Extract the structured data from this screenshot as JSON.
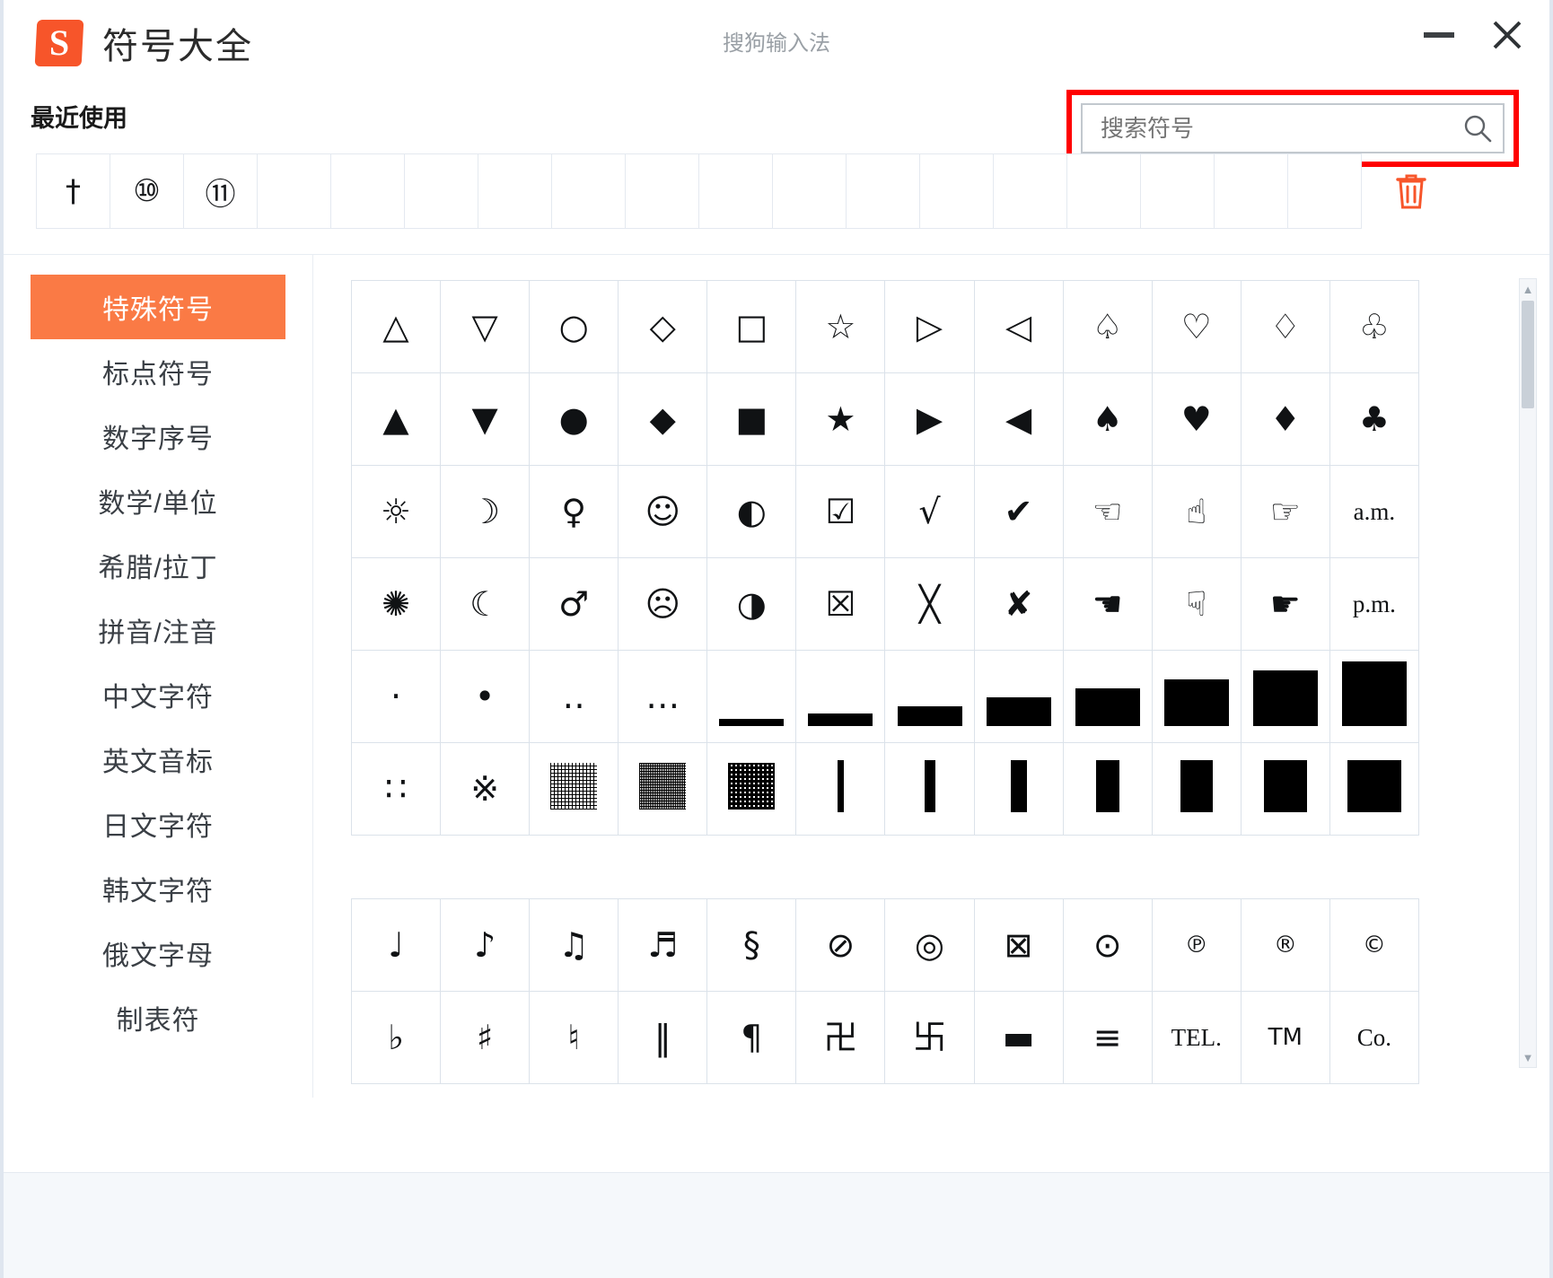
{
  "window": {
    "app_title": "符号大全",
    "window_title": "搜狗输入法",
    "logo_letter": "S",
    "minimize_label": "−",
    "close_label": "×"
  },
  "search": {
    "placeholder": "搜索符号",
    "value": "",
    "icon": "search-icon",
    "highlight_color": "#ff0000"
  },
  "recent": {
    "label": "最近使用",
    "symbols": [
      "†",
      "⑩",
      "⑪",
      "",
      "",
      "",
      "",
      "",
      "",
      "",
      "",
      "",
      "",
      "",
      "",
      "",
      "",
      ""
    ],
    "clear_icon": "trash-icon",
    "clear_color": "#f7552a"
  },
  "sidebar": {
    "active_color": "#fa7a45",
    "items": [
      {
        "label": "特殊符号",
        "active": true
      },
      {
        "label": "标点符号",
        "active": false
      },
      {
        "label": "数字序号",
        "active": false
      },
      {
        "label": "数学/单位",
        "active": false
      },
      {
        "label": "希腊/拉丁",
        "active": false
      },
      {
        "label": "拼音/注音",
        "active": false
      },
      {
        "label": "中文字符",
        "active": false
      },
      {
        "label": "英文音标",
        "active": false
      },
      {
        "label": "日文字符",
        "active": false
      },
      {
        "label": "韩文字符",
        "active": false
      },
      {
        "label": "俄文字母",
        "active": false
      },
      {
        "label": "制表符",
        "active": false
      }
    ]
  },
  "symbols": {
    "group1": [
      [
        "△",
        "▽",
        "○",
        "◇",
        "□",
        "☆",
        "▷",
        "◁",
        "♤",
        "♡",
        "♢",
        "♧"
      ],
      [
        "▲",
        "▼",
        "●",
        "◆",
        "■",
        "★",
        "▶",
        "◀",
        "♠",
        "♥",
        "♦",
        "♣"
      ],
      [
        "☼",
        "☽",
        "♀",
        "☺",
        "◐",
        "☑",
        "√",
        "✔",
        "☜",
        "☝",
        "☞",
        "a.m."
      ],
      [
        "✺",
        "☾",
        "♂",
        "☹",
        "◑",
        "☒",
        "╳",
        "✘",
        "☚",
        "☟",
        "☛",
        "p.m."
      ],
      [
        "·",
        "•",
        "‥",
        "…",
        "▁",
        "▂",
        "▃",
        "▄",
        "▅",
        "▆",
        "▇",
        "█"
      ],
      [
        "∷",
        "※",
        "░",
        "▒",
        "▓",
        "▏",
        "▎",
        "▍",
        "▌",
        "▋",
        "▊",
        "▉"
      ]
    ],
    "group2": [
      [
        "♩",
        "♪",
        "♫",
        "♬",
        "§",
        "⊘",
        "◎",
        "⊠",
        "⊙",
        "℗",
        "®",
        "©"
      ],
      [
        "♭",
        "♯",
        "♮",
        "‖",
        "¶",
        "卍",
        "卐",
        "▬",
        "≡",
        "TEL.",
        "TM",
        "Co."
      ]
    ]
  },
  "scrollbar": {
    "up_arrow": "▲",
    "down_arrow": "▼"
  }
}
